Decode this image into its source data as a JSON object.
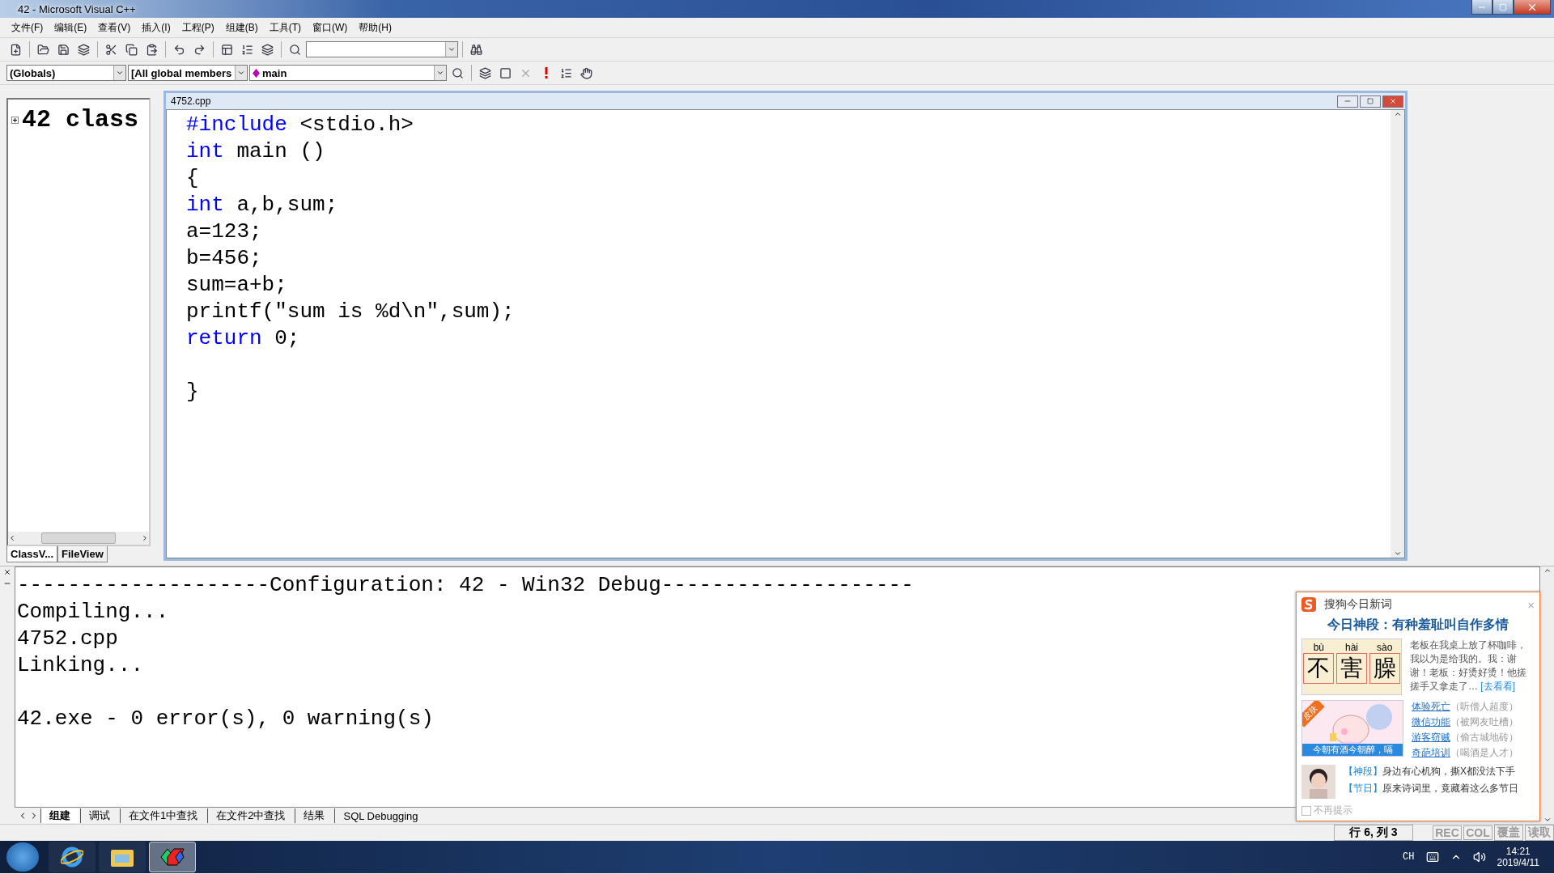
{
  "window": {
    "title": "42 - Microsoft Visual C++"
  },
  "menu": [
    {
      "label": "文件(F)"
    },
    {
      "label": "编辑(E)"
    },
    {
      "label": "查看(V)"
    },
    {
      "label": "插入(I)"
    },
    {
      "label": "工程(P)"
    },
    {
      "label": "组建(B)"
    },
    {
      "label": "工具(T)"
    },
    {
      "label": "窗口(W)"
    },
    {
      "label": "帮助(H)"
    }
  ],
  "toolbar2": {
    "scope": "(Globals)",
    "members": "[All global members",
    "function": "main"
  },
  "workspace": {
    "tree": [
      {
        "label": "42 class",
        "expanded": false
      }
    ],
    "tabs": [
      {
        "label": "ClassV...",
        "selected": true
      },
      {
        "label": "FileView",
        "selected": false
      }
    ]
  },
  "editor": {
    "title": "4752.cpp",
    "lines": [
      {
        "kind": "code",
        "tokens": [
          {
            "text": "#include",
            "kind": "keyword"
          },
          {
            "text": " <stdio.h>",
            "kind": "plain"
          }
        ]
      },
      {
        "kind": "code",
        "tokens": [
          {
            "text": "int",
            "kind": "keyword"
          },
          {
            "text": " main ()",
            "kind": "plain"
          }
        ]
      },
      {
        "kind": "code",
        "tokens": [
          {
            "text": "{",
            "kind": "plain"
          }
        ]
      },
      {
        "kind": "code",
        "tokens": [
          {
            "text": "int",
            "kind": "keyword"
          },
          {
            "text": " a,b,sum;",
            "kind": "plain"
          }
        ]
      },
      {
        "kind": "code",
        "tokens": [
          {
            "text": "a=123;",
            "kind": "plain"
          }
        ]
      },
      {
        "kind": "code",
        "tokens": [
          {
            "text": "b=456;",
            "kind": "plain"
          }
        ]
      },
      {
        "kind": "code",
        "tokens": [
          {
            "text": "sum=a+b;",
            "kind": "plain"
          }
        ]
      },
      {
        "kind": "code",
        "tokens": [
          {
            "text": "printf(\"sum is %d\\n\",sum);",
            "kind": "plain"
          }
        ]
      },
      {
        "kind": "code",
        "tokens": [
          {
            "text": "return",
            "kind": "keyword"
          },
          {
            "text": " 0;",
            "kind": "plain"
          }
        ]
      },
      {
        "kind": "blank"
      },
      {
        "kind": "code",
        "tokens": [
          {
            "text": "}",
            "kind": "plain"
          }
        ]
      }
    ]
  },
  "output": {
    "lines": [
      {
        "kind": "text",
        "text": "--------------------Configuration: 42 - Win32 Debug--------------------"
      },
      {
        "kind": "text",
        "text": "Compiling..."
      },
      {
        "kind": "text",
        "text": "4752.cpp"
      },
      {
        "kind": "text",
        "text": "Linking..."
      },
      {
        "kind": "blank"
      },
      {
        "kind": "text",
        "text": "42.exe - 0 error(s), 0 warning(s)"
      }
    ],
    "tabs": [
      {
        "label": "组建",
        "selected": true
      },
      {
        "label": "调试",
        "selected": false
      },
      {
        "label": "在文件1中查找",
        "selected": false
      },
      {
        "label": "在文件2中查找",
        "selected": false
      },
      {
        "label": "结果",
        "selected": false
      },
      {
        "label": "SQL Debugging",
        "selected": false
      }
    ]
  },
  "popup": {
    "title": "搜狗今日新词",
    "close": "×",
    "headline": "今日神段：有种羞耻叫自作多情",
    "word": [
      {
        "pinyin": "bù",
        "char": "不"
      },
      {
        "pinyin": "hài",
        "char": "害"
      },
      {
        "pinyin": "sào",
        "char": "臊"
      }
    ],
    "story": "老板在我桌上放了杯咖啡，我以为是给我的。我：谢谢！老板：好烫好烫！他搓搓手又拿走了…",
    "story_link": "[去看看]",
    "badge": "皮肤",
    "caption": "今朝有酒今朝醉，嗝",
    "terms": [
      {
        "term": "体验死亡",
        "note": "（听僧人超度）"
      },
      {
        "term": "微信功能",
        "note": "（被网友吐槽）"
      },
      {
        "term": "游客窃贼",
        "note": "（偷古城地砖）"
      },
      {
        "term": "奇葩培训",
        "note": "（喝酒是人才）"
      }
    ],
    "news": [
      {
        "tag": "【神段】",
        "text": "身边有心机狗，撕X都没法下手"
      },
      {
        "tag": "【节日】",
        "text": "原来诗词里，竟藏着这么多节日"
      }
    ],
    "opt_out": {
      "label": "不再提示",
      "checked": false
    }
  },
  "status": {
    "position": "行 6, 列 3",
    "indicators": [
      {
        "label": "REC",
        "active": false
      },
      {
        "label": "COL",
        "active": false
      },
      {
        "label": "覆盖",
        "active": false
      },
      {
        "label": "读取",
        "active": false
      }
    ]
  },
  "taskbar": {
    "apps": [
      {
        "kind": "browser",
        "active": false
      },
      {
        "kind": "folder",
        "active": false
      },
      {
        "kind": "ide",
        "active": true
      }
    ],
    "lang": "CH",
    "time": "14:21",
    "date": "2019/4/11"
  }
}
